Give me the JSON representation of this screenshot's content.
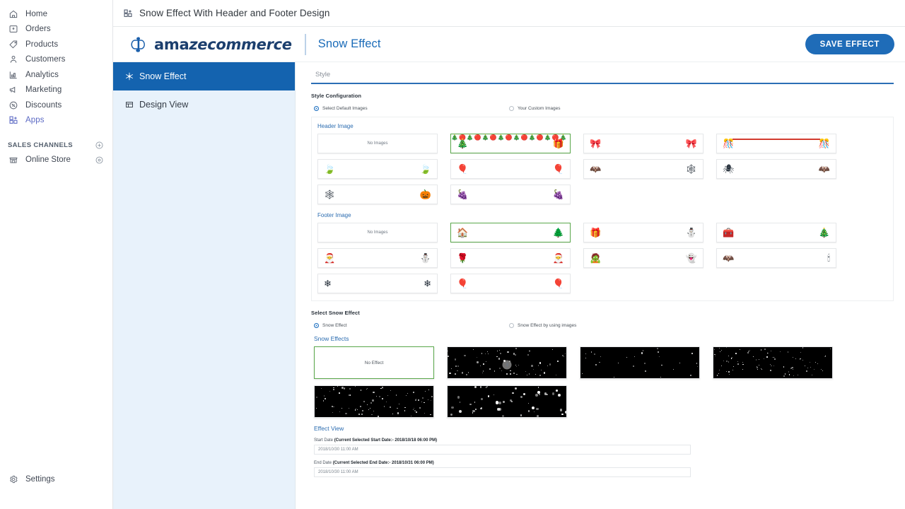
{
  "global_sidebar": {
    "items": [
      {
        "label": "Home",
        "icon": "home-icon"
      },
      {
        "label": "Orders",
        "icon": "orders-inbox-icon"
      },
      {
        "label": "Products",
        "icon": "tag-icon"
      },
      {
        "label": "Customers",
        "icon": "person-icon"
      },
      {
        "label": "Analytics",
        "icon": "bar-chart-icon"
      },
      {
        "label": "Marketing",
        "icon": "megaphone-icon"
      },
      {
        "label": "Discounts",
        "icon": "discount-percent-icon"
      },
      {
        "label": "Apps",
        "icon": "apps-grid-icon"
      }
    ],
    "section_title": "SALES CHANNELS",
    "add_channel_icon": "plus-circle-icon",
    "channels": [
      {
        "label": "Online Store",
        "icon": "storefront-icon",
        "action_icon": "eye-icon"
      }
    ],
    "settings": {
      "label": "Settings",
      "icon": "gear-icon"
    }
  },
  "topbar": {
    "icon": "apps-grid-icon",
    "title": "Snow Effect With Header and Footer Design"
  },
  "app_header": {
    "brand": "amazecommerce",
    "brand_plain": "ama",
    "brand_italic": "zecommerce",
    "page_name": "Snow Effect",
    "save_label": "SAVE EFFECT",
    "accent_color": "#1f6cb8"
  },
  "subnav": {
    "items": [
      {
        "label": "Snow Effect",
        "icon": "snowflake-icon",
        "active": true
      },
      {
        "label": "Design View",
        "icon": "table-grid-icon",
        "active": false
      }
    ]
  },
  "content": {
    "tab_label": "Style",
    "style_configuration_label": "Style Configuration",
    "image_source_options": [
      {
        "label": "Select Default Images",
        "selected": true
      },
      {
        "label": "Your Custom Images",
        "selected": false
      }
    ],
    "header_image": {
      "title": "Header Image",
      "thumbs": [
        {
          "kind": "none",
          "label": "No Images",
          "selected": false
        },
        {
          "kind": "garland",
          "left": "🎄",
          "right": "🎁",
          "selected": true
        },
        {
          "kind": "corners",
          "left": "🎀",
          "right": "🎀",
          "selected": false
        },
        {
          "kind": "redline",
          "left": "🎊",
          "right": "🎊",
          "selected": false
        },
        {
          "kind": "corners",
          "left": "🍃",
          "right": "🍃",
          "selected": false
        },
        {
          "kind": "corners",
          "left": "🎈",
          "right": "🎈",
          "selected": false
        },
        {
          "kind": "corners",
          "left": "🦇",
          "right": "🕸",
          "selected": false
        },
        {
          "kind": "corners",
          "left": "🕷",
          "right": "🦇",
          "selected": false
        },
        {
          "kind": "corners",
          "left": "🕸",
          "right": "🎃",
          "selected": false
        },
        {
          "kind": "corners",
          "left": "🍇",
          "right": "🍇",
          "selected": false
        }
      ]
    },
    "footer_image": {
      "title": "Footer Image",
      "thumbs": [
        {
          "kind": "none",
          "label": "No Images",
          "selected": false
        },
        {
          "kind": "corners",
          "left": "🏠",
          "right": "🌲",
          "selected": true
        },
        {
          "kind": "corners",
          "left": "🎁",
          "right": "⛄",
          "selected": false
        },
        {
          "kind": "corners",
          "left": "🧰",
          "right": "🎄",
          "selected": false
        },
        {
          "kind": "corners",
          "left": "🎅",
          "right": "⛄",
          "selected": false
        },
        {
          "kind": "corners",
          "left": "🌹",
          "right": "🎅",
          "selected": false
        },
        {
          "kind": "corners",
          "left": "🧟",
          "right": "👻",
          "selected": false
        },
        {
          "kind": "corners",
          "left": "🦇",
          "right": "🕯",
          "selected": false
        },
        {
          "kind": "corners",
          "left": "❄",
          "right": "❄",
          "selected": false
        },
        {
          "kind": "corners",
          "left": "🎈",
          "right": "🎈",
          "selected": false
        }
      ]
    },
    "select_snow_effect_label": "Select Snow Effect",
    "snow_effect_options": [
      {
        "label": "Snow Effect",
        "selected": true
      },
      {
        "label": "Snow Effect by using images",
        "selected": false
      }
    ],
    "snow_effects": {
      "title": "Snow Effects",
      "thumbs": [
        {
          "kind": "none",
          "label": "No Effect",
          "selected": true,
          "density": 0,
          "size": 0,
          "loading": false
        },
        {
          "kind": "snow",
          "selected": false,
          "density": 70,
          "size": 1.3,
          "loading": true
        },
        {
          "kind": "snow",
          "selected": false,
          "density": 28,
          "size": 1.1,
          "loading": false
        },
        {
          "kind": "snow",
          "selected": false,
          "density": 90,
          "size": 0.9,
          "loading": false
        },
        {
          "kind": "snow",
          "selected": false,
          "density": 85,
          "size": 1.2,
          "loading": false
        },
        {
          "kind": "snow",
          "selected": false,
          "density": 50,
          "size": 2.2,
          "loading": false
        }
      ]
    },
    "effect_view": {
      "title": "Effect View",
      "start_date_label_prefix": "Start Date ",
      "start_date_label_bold": "(Current Selected Start Date:- 2018/10/18 06:00 PM)",
      "start_date_value": "2018/10/30 11:00 AM",
      "end_date_label_prefix": "End Date ",
      "end_date_label_bold": "(Current Selected End Date:- 2018/10/31 06:00 PM)",
      "end_date_value": "2018/10/30 11:00 AM"
    }
  }
}
